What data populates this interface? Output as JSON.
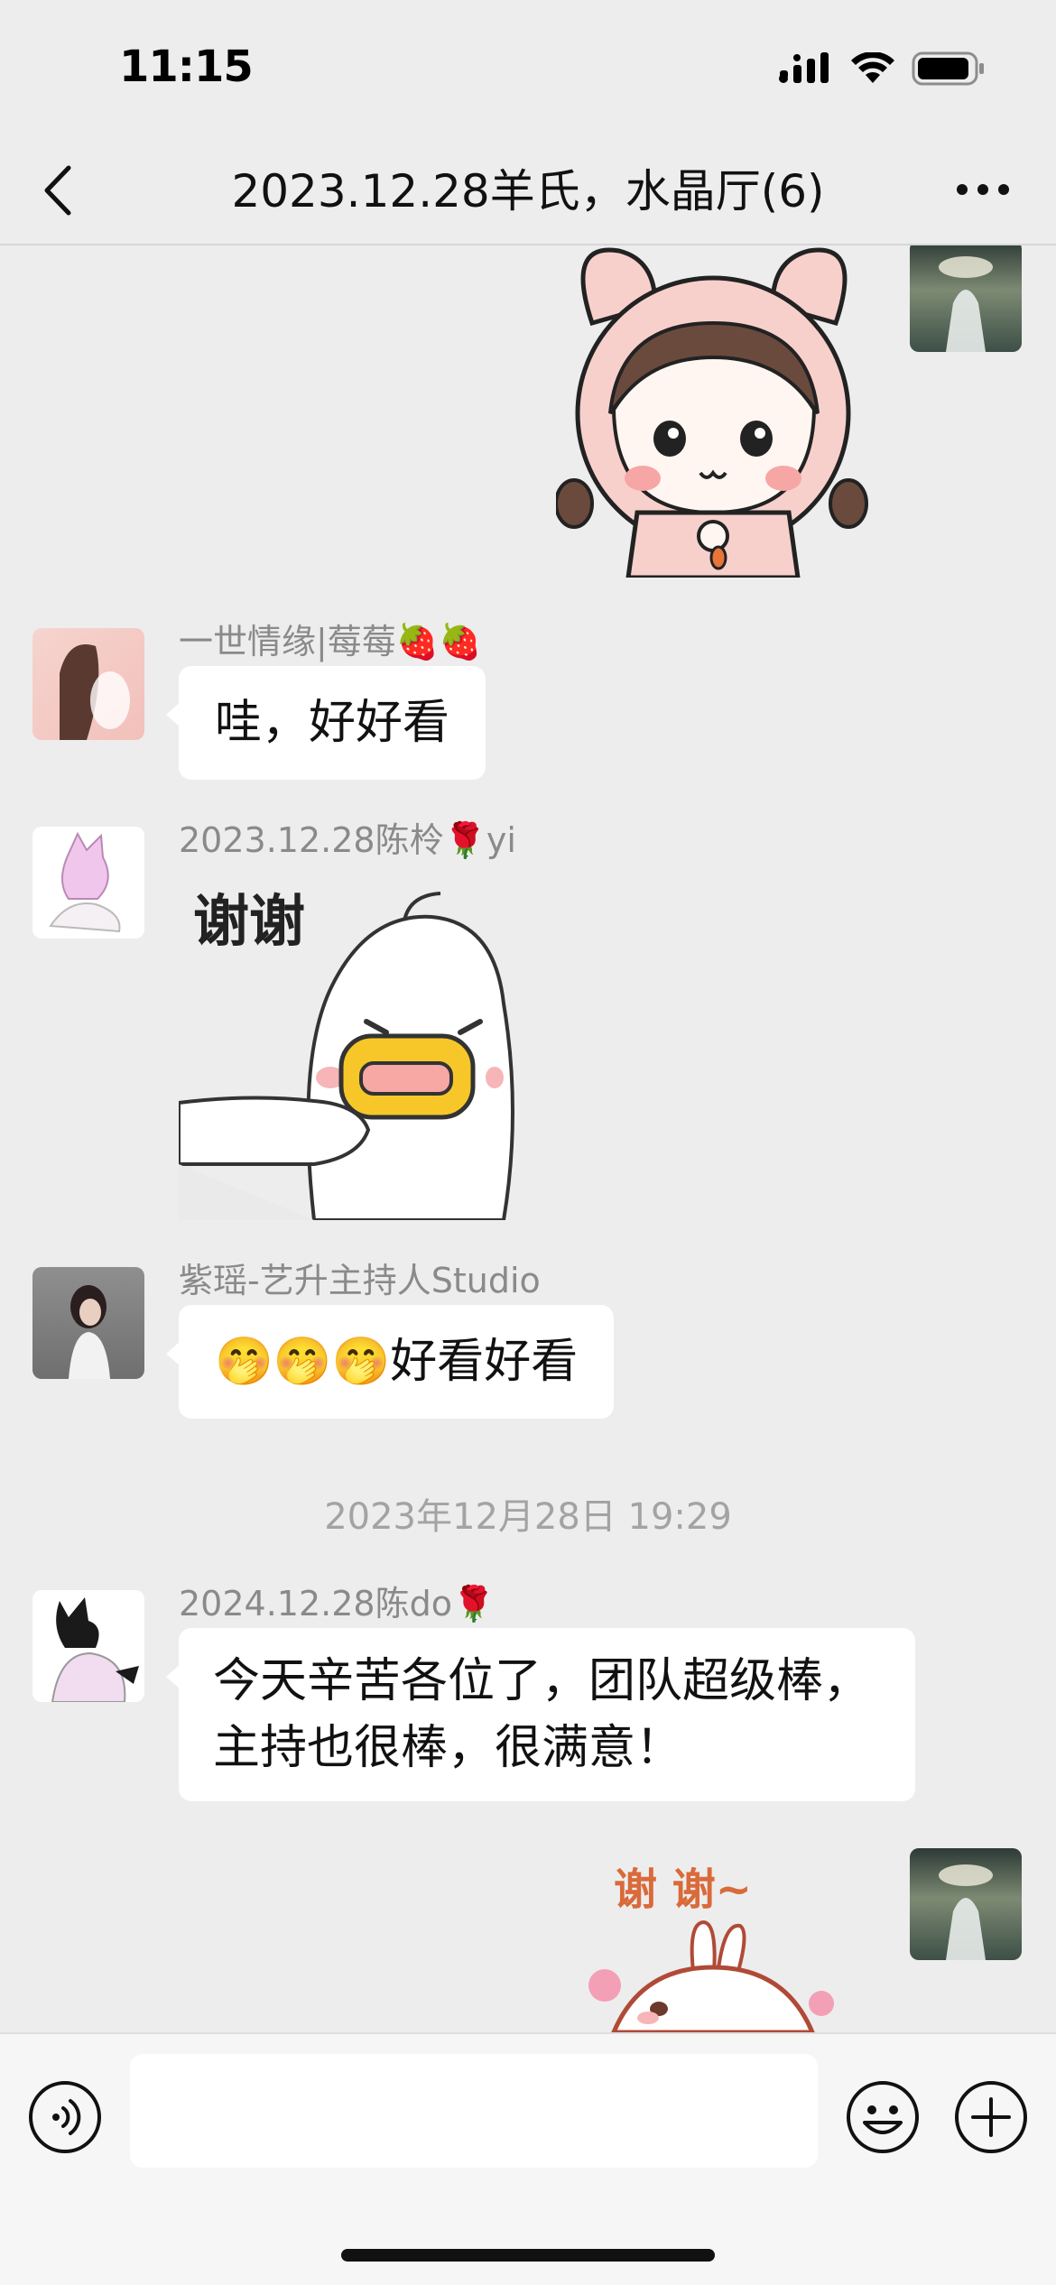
{
  "status_bar": {
    "time": "11:15",
    "icons": [
      "signal-icon",
      "wifi-icon",
      "battery-icon"
    ]
  },
  "nav": {
    "title": "2023.12.28羊氏，水晶厅(6)",
    "icons": [
      "back-icon",
      "more-icon"
    ]
  },
  "messages": [
    {
      "type": "sticker",
      "side": "right",
      "description_icon": "bunny-girl-sticker"
    },
    {
      "type": "text",
      "side": "left",
      "sender": "一世情缘|莓莓🍓🍓",
      "text": "哇，好好看"
    },
    {
      "type": "sticker",
      "side": "left",
      "sender": "2023.12.28陈柃🌹yi",
      "sticker_text": "谢谢"
    },
    {
      "type": "text",
      "side": "left",
      "sender": "紫瑶-艺升主持人Studio",
      "text": "🤭🤭🤭好看好看"
    },
    {
      "type": "timestamp",
      "text": "2023年12月28日 19:29"
    },
    {
      "type": "text",
      "side": "left",
      "sender": "2024.12.28陈do🌹",
      "text_lines": [
        "今天辛苦各位了，团队超级棒，",
        "主持也很棒，很满意！"
      ]
    },
    {
      "type": "sticker",
      "side": "right",
      "sticker_text": "谢 谢~"
    }
  ],
  "input_bar": {
    "placeholder": "",
    "icons": [
      "voice-icon",
      "emoji-icon",
      "plus-icon"
    ]
  },
  "colors": {
    "background": "#ededed",
    "bubble": "#ffffff",
    "sender_text": "#8a8a8a",
    "timestamp_text": "#a3a3a3"
  }
}
